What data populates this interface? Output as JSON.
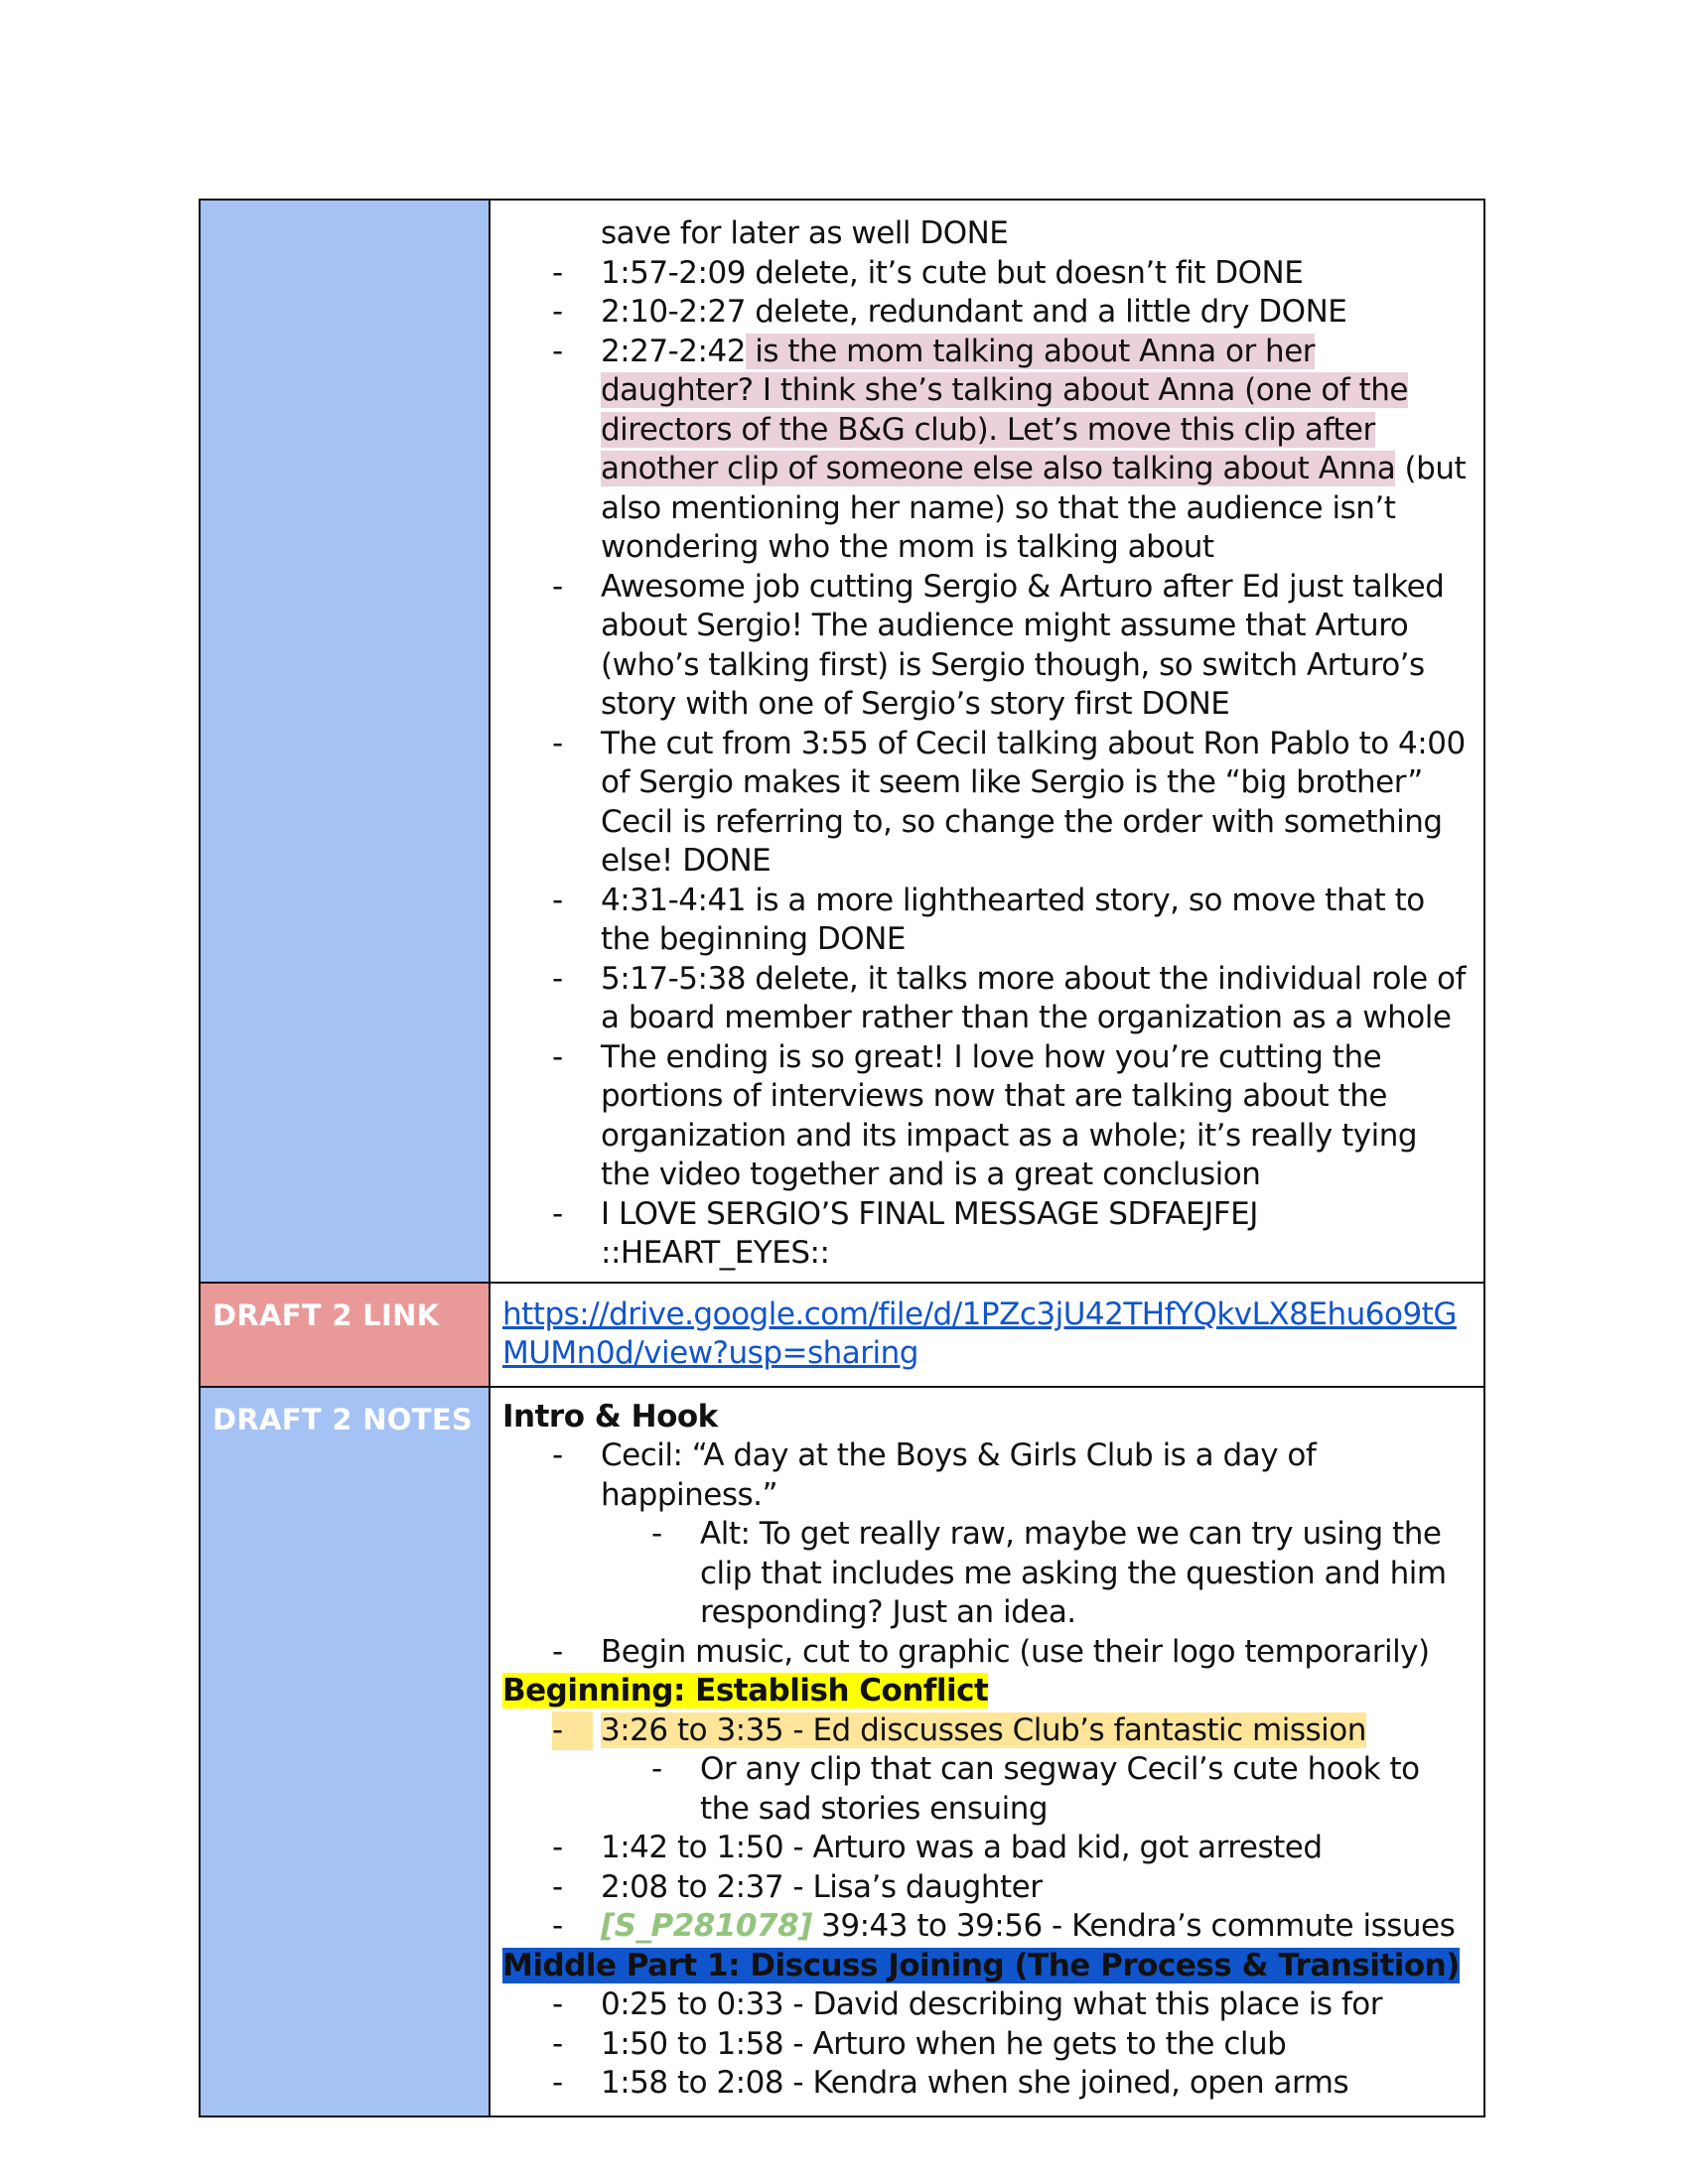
{
  "row1": {
    "continuation": "save for later as well DONE",
    "items": [
      {
        "text": "1:57-2:09 delete, it’s cute but doesn’t fit DONE"
      },
      {
        "text": "2:10-2:27 delete, redundant and a little dry DONE"
      },
      {
        "pre": "2:27-2:42",
        "highlight": " is the mom talking about Anna or her daughter? I think she’s talking about Anna (one of the directors of the B&G club). Let’s move this clip after another clip of someone else also talking about Anna",
        "post": " (but also mentioning her name) so that the audience isn’t wondering who the mom is talking about"
      },
      {
        "text": "Awesome job cutting Sergio & Arturo after Ed just talked about Sergio! The audience might assume that Arturo (who’s talking first) is Sergio though, so switch Arturo’s story with one of Sergio’s story first DONE"
      },
      {
        "text": "The cut from 3:55 of Cecil talking about Ron Pablo to 4:00 of Sergio makes it seem like Sergio is the “big brother” Cecil is referring to, so change the order with something else! DONE"
      },
      {
        "text": "4:31-4:41 is a more lighthearted story, so move that to the beginning DONE"
      },
      {
        "text": "5:17-5:38 delete, it talks more about the individual role of a board member rather than the organization as a whole"
      },
      {
        "text": "The ending is so great! I love how you’re cutting the portions of interviews now that are talking about the organization and its impact as a whole; it’s really tying the video together and is a great conclusion"
      },
      {
        "text": "I LOVE SERGIO’S FINAL MESSAGE SDFAEJFEJ ::HEART_EYES::"
      }
    ]
  },
  "row2": {
    "label": "DRAFT 2 LINK",
    "link": "https://drive.google.com/file/d/1PZc3jU42THfYQkvLX8Ehu6o9tGMUMn0d/view?usp=sharing"
  },
  "row3": {
    "label": "DRAFT 2 NOTES",
    "intro_heading": "Intro & Hook",
    "intro_item1": "Cecil: “A day at the Boys & Girls Club is a day of happiness.”",
    "intro_sub1": "Alt: To get really raw, maybe we can try using the clip that includes me asking the question and him responding? Just an idea.",
    "intro_item2": "Begin music, cut to graphic (use their logo temporarily)",
    "beginning_heading": "Beginning: Establish Conflict",
    "beginning_item1": "3:26 to 3:35 - Ed discusses Club’s fantastic mission",
    "beginning_sub1": "Or any clip that can segway Cecil’s cute hook to the sad stories ensuing",
    "beginning_item2": "1:42 to 1:50 - Arturo was a bad kid, got arrested",
    "beginning_item3": "2:08 to 2:37 - Lisa’s daughter",
    "beginning_item4_tag": "[S_P281078]",
    "beginning_item4_text": " 39:43 to 39:56 - Kendra’s commute issues",
    "middle_heading": "Middle Part 1: Discuss Joining (The Process & Transition)",
    "middle_items": [
      "0:25 to 0:33 - David describing what this place is for",
      "1:50 to 1:58 - Arturo when he gets to the club",
      "1:58 to 2:08 - Kendra when she joined, open arms"
    ]
  },
  "dash": "-",
  "colors": {
    "label_blue": "#a4c2f4",
    "label_red": "#ea9999",
    "pink_highlight": "#ead1dc",
    "orange_highlight": "#ffe599",
    "yellow_highlight": "#ffff00",
    "blue_highlight": "#1155cc",
    "link": "#1155cc",
    "tag_green": "#93c47d"
  }
}
